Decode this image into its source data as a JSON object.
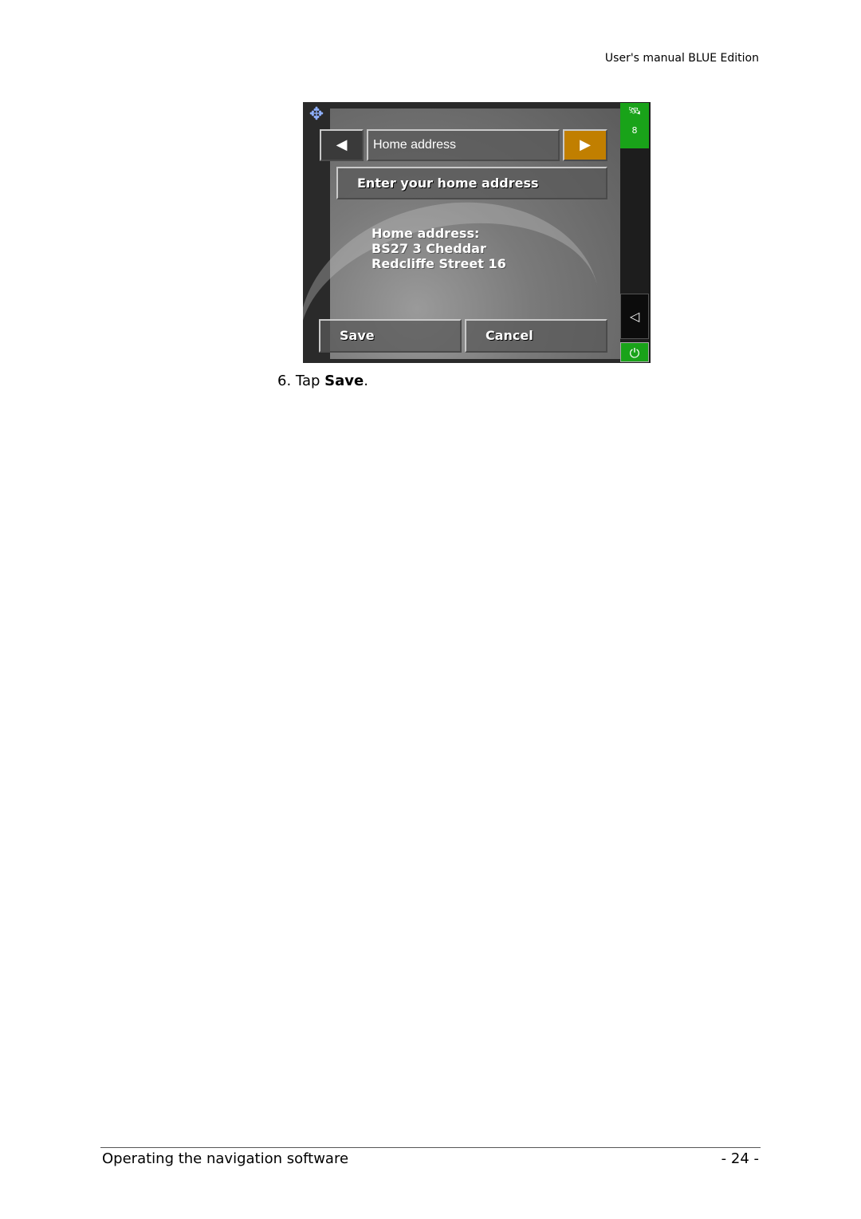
{
  "header": {
    "title": "User's manual BLUE Edition"
  },
  "screenshot": {
    "icons": {
      "compass": "compass-arrows-icon",
      "gps": "satellite-icon",
      "back": "back-triangle-icon",
      "power": "power-plug-icon"
    },
    "prev_glyph": "◀",
    "title_field": "Home address",
    "next_glyph": "▶",
    "enter_button": "Enter your home address",
    "address_lines": [
      "Home address:",
      "BS27 3 Cheddar",
      "Redcliffe Street 16"
    ],
    "save_button": "Save",
    "cancel_button": "Cancel",
    "gps_count": "8",
    "gps_glyph": "🛰",
    "back_glyph": "◁",
    "power_glyph": "⏻",
    "compass_glyph": "✥",
    "colors": {
      "accent_orange": "#c17f00",
      "status_green": "#19a319"
    }
  },
  "step": {
    "number": "6.",
    "prefix": "Tap ",
    "bold": "Save",
    "suffix": "."
  },
  "footer": {
    "section": "Operating the navigation software",
    "page": "- 24 -"
  }
}
